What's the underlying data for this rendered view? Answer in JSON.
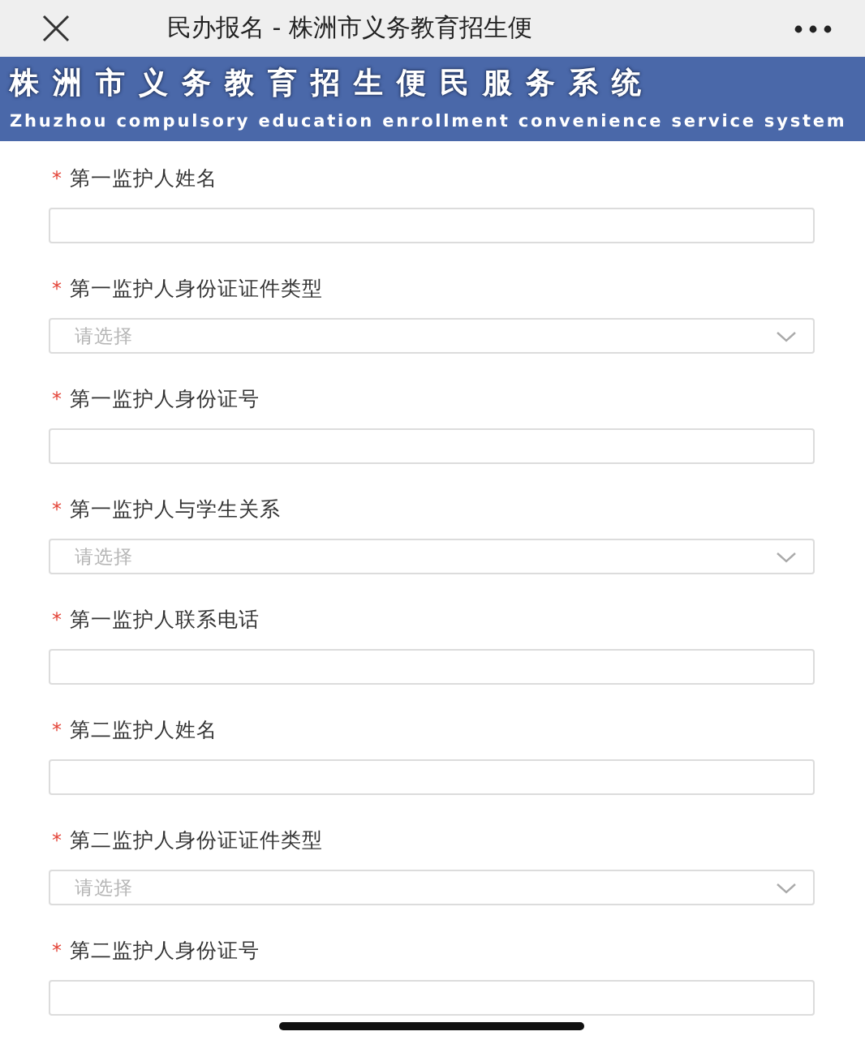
{
  "window": {
    "title": "民办报名 - 株洲市义务教育招生便"
  },
  "banner": {
    "title": "株洲市义务教育招生便民服务系统",
    "subtitle": "Zhuzhou compulsory education enrollment convenience service system"
  },
  "fields": [
    {
      "kind": "text",
      "label": "第一监护人姓名",
      "required": true
    },
    {
      "kind": "select",
      "label": "第一监护人身份证证件类型",
      "required": true,
      "placeholder": "请选择"
    },
    {
      "kind": "text",
      "label": "第一监护人身份证号",
      "required": true
    },
    {
      "kind": "select",
      "label": "第一监护人与学生关系",
      "required": true,
      "placeholder": "请选择"
    },
    {
      "kind": "text",
      "label": "第一监护人联系电话",
      "required": true
    },
    {
      "kind": "text",
      "label": "第二监护人姓名",
      "required": true
    },
    {
      "kind": "select",
      "label": "第二监护人身份证证件类型",
      "required": true,
      "placeholder": "请选择"
    },
    {
      "kind": "text",
      "label": "第二监护人身份证号",
      "required": true
    }
  ],
  "required_mark": "*"
}
